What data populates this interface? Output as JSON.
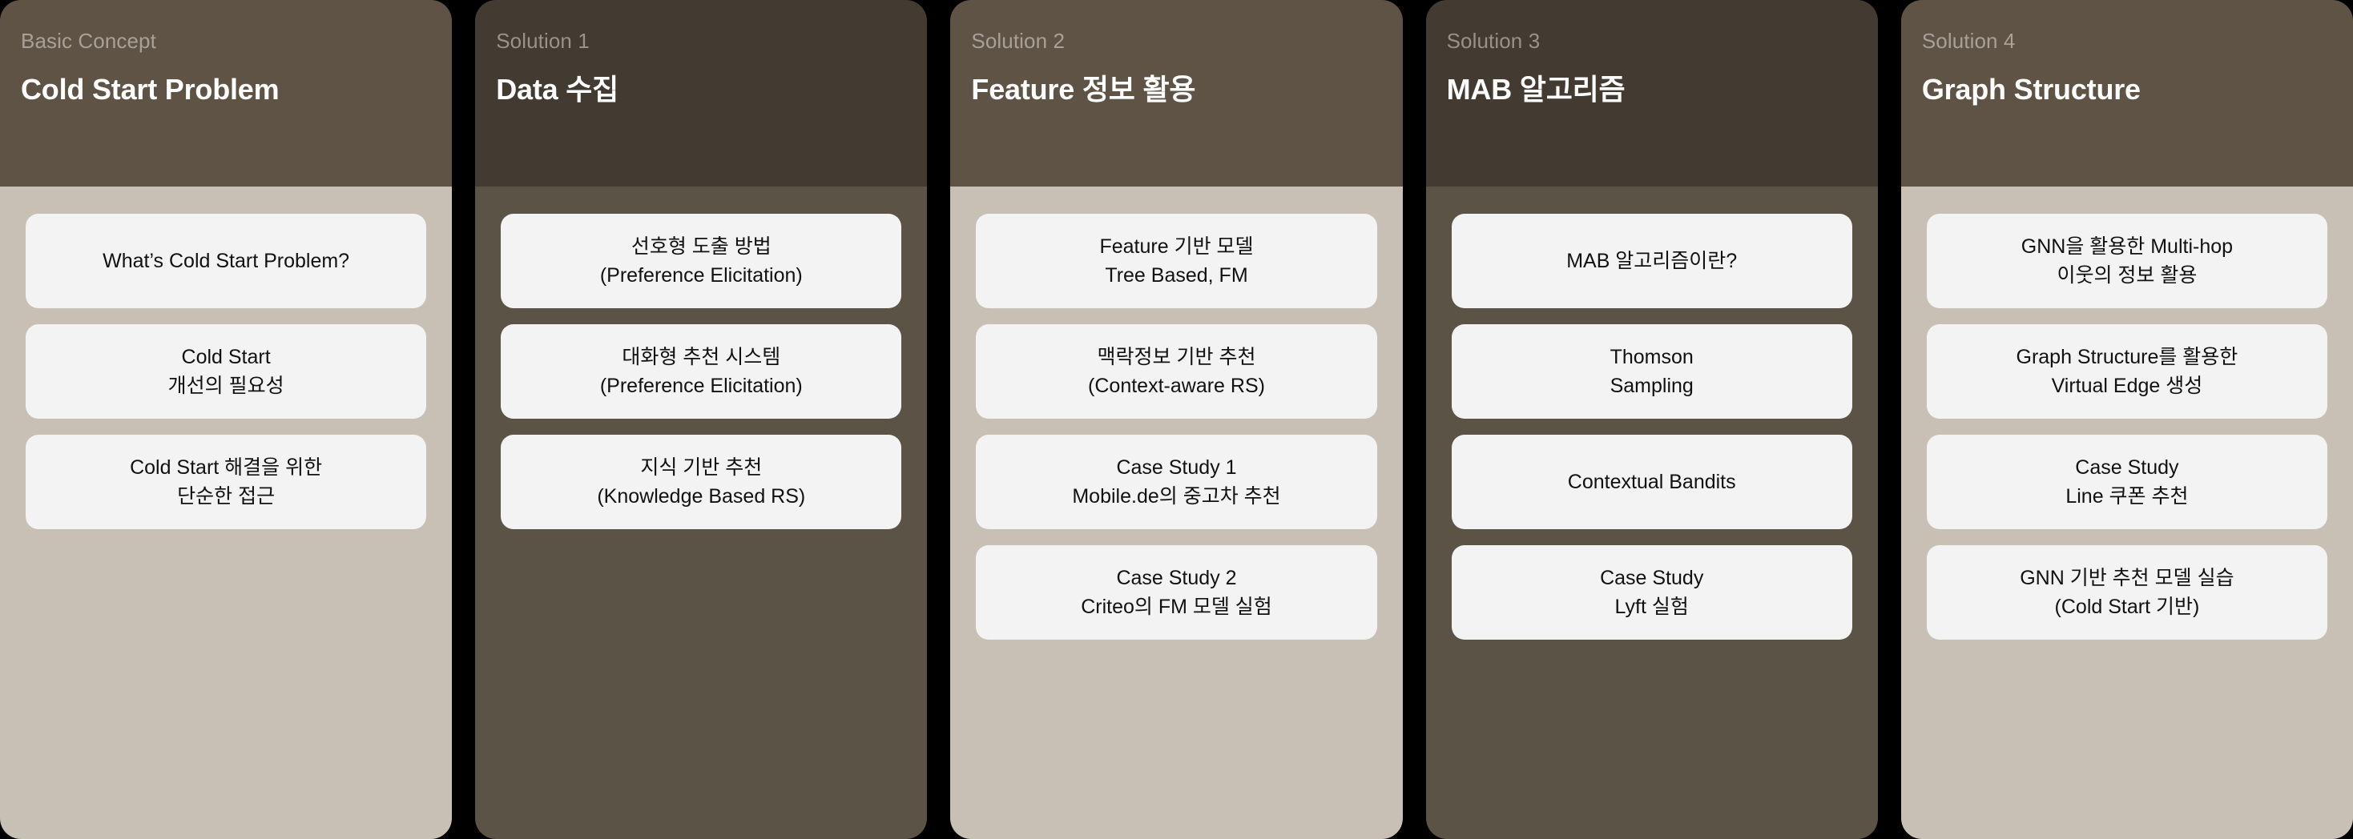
{
  "background_color": "#000000",
  "columns": [
    {
      "theme": "light",
      "header_bg": "#5e5345",
      "body_bg": "#c8c0b5",
      "eyebrow": "Basic Concept",
      "title": "Cold Start Problem",
      "cards": [
        {
          "line1": "What’s Cold Start Problem?",
          "line2": ""
        },
        {
          "line1": "Cold Start",
          "line2": "개선의 필요성"
        },
        {
          "line1": "Cold Start 해결을 위한",
          "line2": "단순한 접근"
        }
      ]
    },
    {
      "theme": "dark",
      "header_bg": "#433b31",
      "body_bg": "#5c5347",
      "eyebrow": "Solution 1",
      "title": "Data 수집",
      "cards": [
        {
          "line1": "선호형 도출 방법",
          "line2": "(Preference Elicitation)"
        },
        {
          "line1": "대화형 추천 시스템",
          "line2": "(Preference Elicitation)"
        },
        {
          "line1": "지식 기반 추천",
          "line2": "(Knowledge Based RS)"
        }
      ]
    },
    {
      "theme": "light",
      "header_bg": "#5e5345",
      "body_bg": "#c8c0b5",
      "eyebrow": "Solution 2",
      "title": "Feature 정보 활용",
      "cards": [
        {
          "line1": "Feature 기반 모델",
          "line2": "Tree Based, FM"
        },
        {
          "line1": "맥락정보 기반 추천",
          "line2": "(Context-aware RS)"
        },
        {
          "line1": "Case Study 1",
          "line2": "Mobile.de의 중고차 추천"
        },
        {
          "line1": "Case Study 2",
          "line2": "Criteo의 FM 모델 실험"
        }
      ]
    },
    {
      "theme": "dark",
      "header_bg": "#433b31",
      "body_bg": "#5c5347",
      "eyebrow": "Solution 3",
      "title": "MAB 알고리즘",
      "cards": [
        {
          "line1": "MAB 알고리즘이란?",
          "line2": ""
        },
        {
          "line1": "Thomson",
          "line2": "Sampling"
        },
        {
          "line1": "Contextual Bandits",
          "line2": ""
        },
        {
          "line1": "Case Study",
          "line2": "Lyft 실험"
        }
      ]
    },
    {
      "theme": "light",
      "header_bg": "#5e5345",
      "body_bg": "#c8c0b5",
      "eyebrow": "Solution 4",
      "title": "Graph Structure",
      "cards": [
        {
          "line1": "GNN을 활용한 Multi-hop",
          "line2": "이웃의 정보 활용"
        },
        {
          "line1": "Graph Structure를 활용한",
          "line2": "Virtual Edge 생성"
        },
        {
          "line1": "Case Study",
          "line2": "Line 쿠폰 추천"
        },
        {
          "line1": "GNN 기반 추천 모델 실습",
          "line2": "(Cold Start 기반)"
        }
      ]
    }
  ]
}
